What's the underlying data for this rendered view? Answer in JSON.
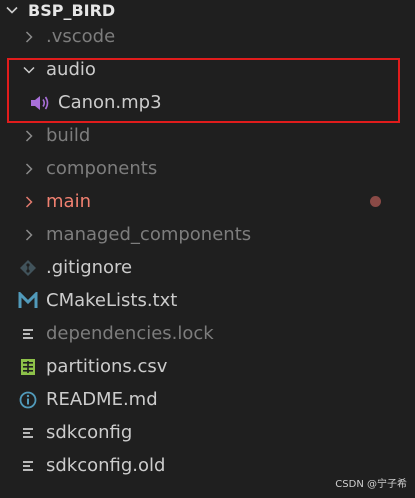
{
  "explorer": {
    "root": {
      "label": "BSP_BIRD"
    },
    "items": [
      {
        "label": ".vscode",
        "kind": "folder",
        "state": "collapsed"
      },
      {
        "label": "audio",
        "kind": "folder",
        "state": "expanded"
      },
      {
        "label": "Canon.mp3",
        "kind": "file",
        "icon": "audio-file-icon"
      },
      {
        "label": "build",
        "kind": "folder",
        "state": "collapsed"
      },
      {
        "label": "components",
        "kind": "folder",
        "state": "collapsed"
      },
      {
        "label": "main",
        "kind": "folder",
        "state": "collapsed",
        "status": "modified"
      },
      {
        "label": "managed_components",
        "kind": "folder",
        "state": "collapsed"
      },
      {
        "label": ".gitignore",
        "kind": "file",
        "icon": "git-icon"
      },
      {
        "label": "CMakeLists.txt",
        "kind": "file",
        "icon": "cmake-m-icon"
      },
      {
        "label": "dependencies.lock",
        "kind": "file",
        "icon": "lines-icon"
      },
      {
        "label": "partitions.csv",
        "kind": "file",
        "icon": "csv-table-icon"
      },
      {
        "label": "README.md",
        "kind": "file",
        "icon": "info-icon"
      },
      {
        "label": "sdkconfig",
        "kind": "file",
        "icon": "lines-icon"
      },
      {
        "label": "sdkconfig.old",
        "kind": "file",
        "icon": "lines-icon"
      }
    ]
  },
  "colors": {
    "background": "#1f1f1f",
    "text": "#cccccc",
    "dimmed_text": "#7d7d7d",
    "modified_text": "#f08070",
    "highlight_border": "#e11c1c"
  },
  "watermark": {
    "text": "CSDN @宁子希"
  }
}
